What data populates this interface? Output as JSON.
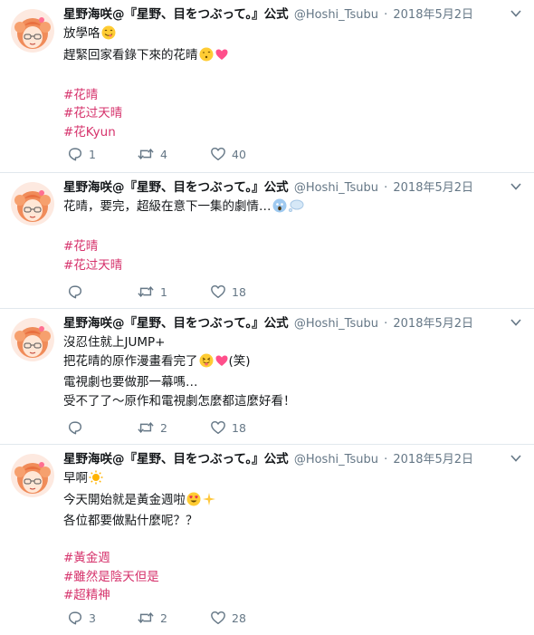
{
  "tweets": [
    {
      "name": "星野海咲@『星野、目をつぶって。』公式",
      "handle": "@Hoshi_Tsubu",
      "date": "2018年5月2日",
      "lines": [
        "放學咯",
        "趕緊回家看錄下來的花晴",
        "",
        "#花晴",
        "#花过天晴",
        "#花Kyun"
      ],
      "replies": "1",
      "retweets": "4",
      "likes": "40"
    },
    {
      "name": "星野海咲@『星野、目をつぶって。』公式",
      "handle": "@Hoshi_Tsubu",
      "date": "2018年5月2日",
      "lines": [
        "花晴，要完，超級在意下一集的劇情…",
        "",
        "#花晴",
        "#花过天晴"
      ],
      "replies": "",
      "retweets": "1",
      "likes": "18"
    },
    {
      "name": "星野海咲@『星野、目をつぶって。』公式",
      "handle": "@Hoshi_Tsubu",
      "date": "2018年5月2日",
      "lines": [
        "沒忍住就上JUMP+",
        "把花晴的原作漫畫看完了",
        "(笑)",
        "電視劇也要做那一幕嗎…",
        "受不了了～原作和電視劇怎麼都這麼好看！"
      ],
      "replies": "",
      "retweets": "2",
      "likes": "18"
    },
    {
      "name": "星野海咲@『星野、目をつぶって。』公式",
      "handle": "@Hoshi_Tsubu",
      "date": "2018年5月2日",
      "lines": [
        "早啊",
        "今天開始就是黃金週啦",
        "各位都要做點什麼呢？？",
        "",
        "#黃金週",
        "#雖然是陰天但是",
        "#超精神"
      ],
      "replies": "3",
      "retweets": "2",
      "likes": "28"
    }
  ],
  "colors": {
    "hashtag": "#d6336c",
    "muted": "#657786",
    "divider": "#e1e8ed"
  },
  "icons": [
    "reply-icon",
    "retweet-icon",
    "like-icon",
    "caret-down-icon"
  ]
}
